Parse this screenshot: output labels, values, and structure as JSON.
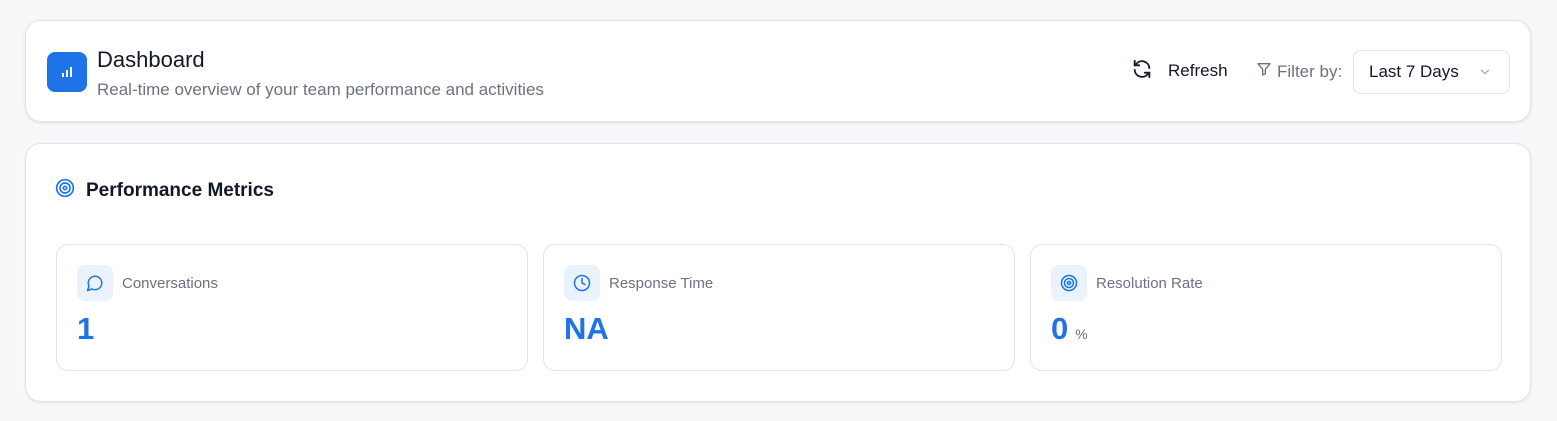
{
  "header": {
    "title": "Dashboard",
    "subtitle": "Real-time overview of your team performance and activities",
    "icon": "bar-chart-icon",
    "refresh_label": "Refresh",
    "filter_label": "Filter by:",
    "filter_selected": "Last 7 Days"
  },
  "metrics_section": {
    "title": "Performance Metrics",
    "icon": "target-icon",
    "cards": [
      {
        "label": "Conversations",
        "value": "1",
        "unit": "",
        "icon": "message-circle-icon"
      },
      {
        "label": "Response Time",
        "value": "NA",
        "unit": "",
        "icon": "clock-icon"
      },
      {
        "label": "Resolution Rate",
        "value": "0",
        "unit": "%",
        "icon": "target-icon"
      }
    ]
  },
  "colors": {
    "accent": "#1f73e8",
    "icon_bg": "#eaf2fd",
    "muted_text": "#6b7280",
    "border": "#e2e4e8",
    "page_bg": "#f7f8fa"
  }
}
